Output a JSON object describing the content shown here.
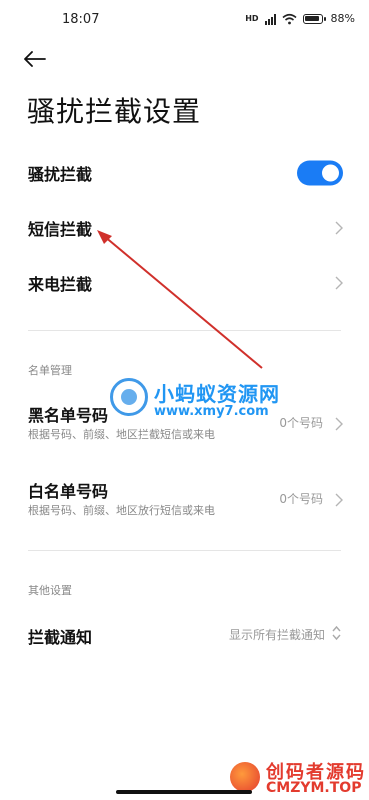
{
  "status_bar": {
    "time": "18:07",
    "hd_label": "HD",
    "battery_text": "88%"
  },
  "header": {
    "title": "骚扰拦截设置"
  },
  "settings": {
    "harass_intercept": {
      "label": "骚扰拦截",
      "enabled": true
    },
    "sms_intercept": {
      "label": "短信拦截"
    },
    "call_intercept": {
      "label": "来电拦截"
    }
  },
  "list_management": {
    "header": "名单管理",
    "blacklist": {
      "title": "黑名单号码",
      "subtitle": "根据号码、前缀、地区拦截短信或来电",
      "value": "0个号码"
    },
    "whitelist": {
      "title": "白名单号码",
      "subtitle": "根据号码、前缀、地区放行短信或来电",
      "value": "0个号码"
    }
  },
  "other_settings": {
    "header": "其他设置",
    "intercept_notify": {
      "title": "拦截通知",
      "value": "显示所有拦截通知"
    }
  },
  "watermarks": {
    "center_title": "小蚂蚁资源网",
    "center_url": "www.xmy7.com",
    "corner_title": "创码者源码",
    "corner_url": "CMZYM.TOP"
  },
  "colors": {
    "accent": "#1a7cf5",
    "annotation_arrow": "#d0302b"
  }
}
